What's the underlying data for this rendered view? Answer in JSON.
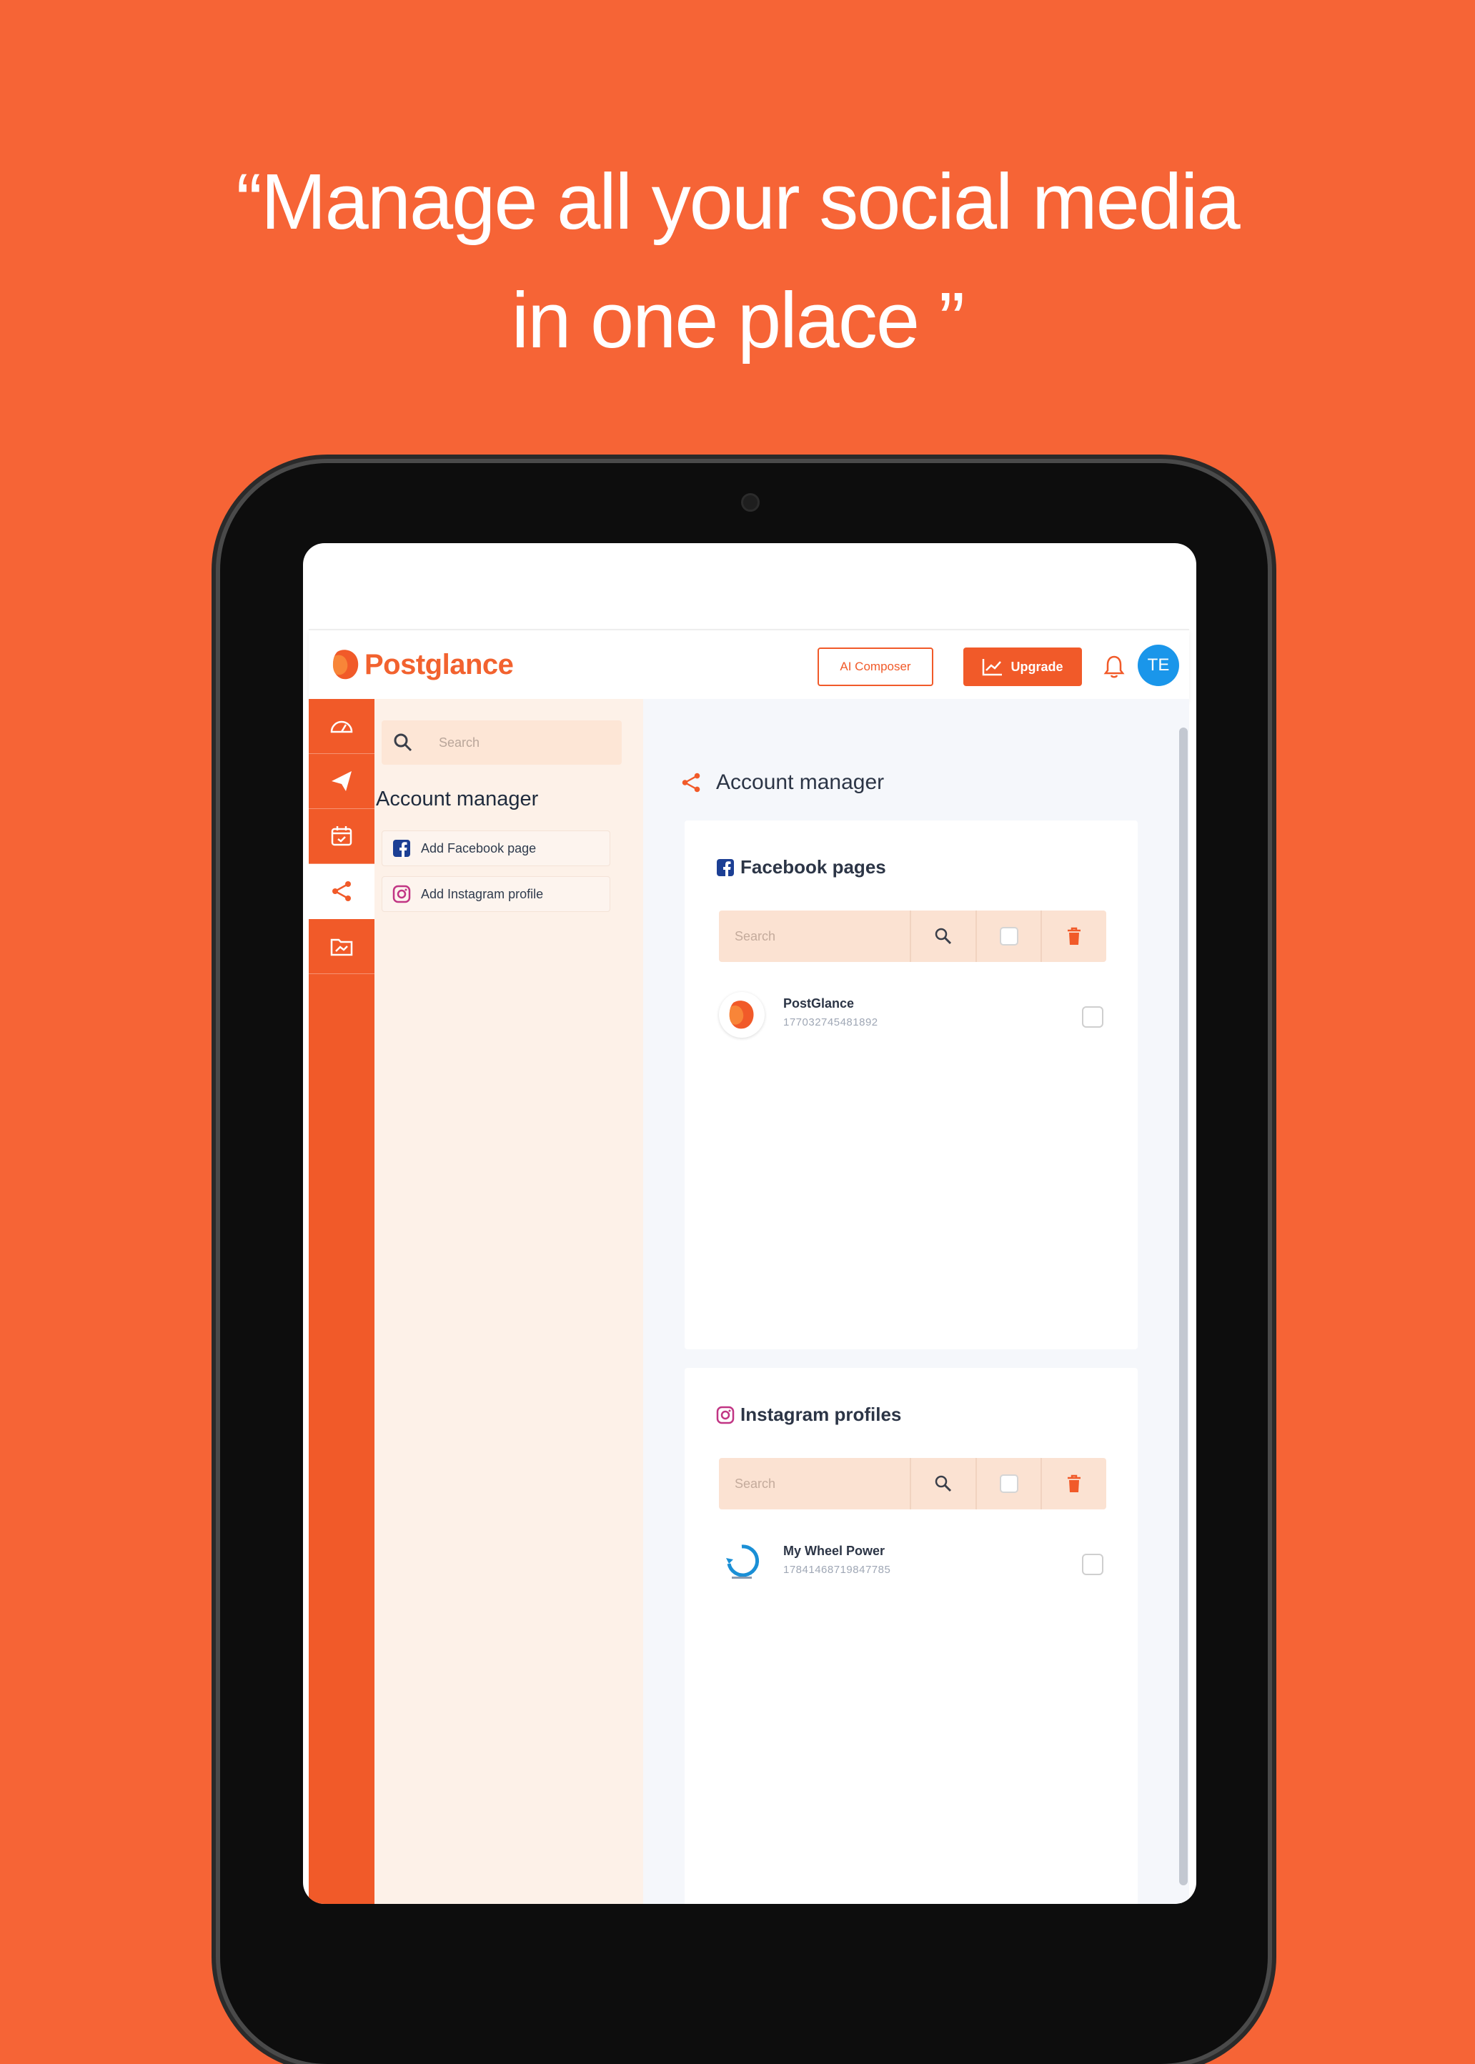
{
  "headline": {
    "line1": "“Manage all your social media",
    "line2": "in one place ”"
  },
  "colors": {
    "brand": "#f15a29",
    "background": "#f66436",
    "avatar": "#1a96ea"
  },
  "app": {
    "brand_name": "Postglance",
    "topbar": {
      "ai_composer_label": "AI Composer",
      "upgrade_label": "Upgrade",
      "avatar_initials": "TE"
    },
    "icon_sidebar": [
      {
        "icon": "dashboard-gauge-icon",
        "active": false
      },
      {
        "icon": "paper-plane-icon",
        "active": false
      },
      {
        "icon": "calendar-icon",
        "active": false
      },
      {
        "icon": "share-icon",
        "active": true
      },
      {
        "icon": "folder-image-icon",
        "active": false
      }
    ],
    "side_panel": {
      "search_placeholder": "Search",
      "title": "Account manager",
      "links": [
        {
          "icon": "facebook-icon",
          "label": "Add Facebook page"
        },
        {
          "icon": "instagram-icon",
          "label": "Add Instagram profile"
        }
      ]
    },
    "main": {
      "title": "Account manager",
      "sections": [
        {
          "title": "Facebook pages",
          "search_placeholder": "Search",
          "accounts": [
            {
              "name": "PostGlance",
              "id": "177032745481892"
            }
          ]
        },
        {
          "title": "Instagram profiles",
          "search_placeholder": "Search",
          "accounts": [
            {
              "name": "My Wheel Power",
              "id": "17841468719847785"
            }
          ]
        }
      ]
    }
  }
}
